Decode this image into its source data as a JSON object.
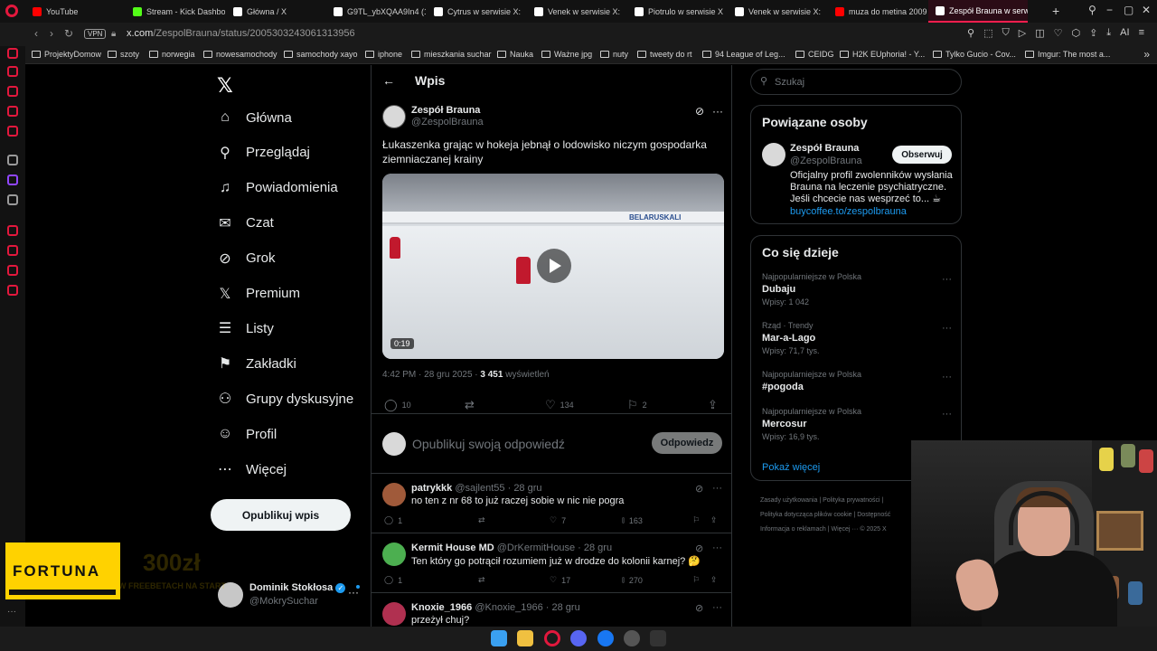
{
  "browser": {
    "tabs": [
      {
        "label": "YouTube",
        "color": "#ff0000"
      },
      {
        "label": "Stream - Kick Dashbo",
        "color": "#53fc18"
      },
      {
        "label": "Główna / X",
        "color": "#ffffff"
      },
      {
        "label": "G9TL_ybXQAA9In4 (1",
        "color": "#ffffff"
      },
      {
        "label": "Cytrus w serwisie X:",
        "color": "#ffffff"
      },
      {
        "label": "Venek w serwisie X:",
        "color": "#ffffff"
      },
      {
        "label": "Piotrulo w serwisie X",
        "color": "#ffffff"
      },
      {
        "label": "Venek w serwisie X:",
        "color": "#ffffff"
      },
      {
        "label": "muza do metina 2009",
        "color": "#ff0000"
      },
      {
        "label": "Zespół Brauna w serwisie",
        "color": "#ffffff"
      }
    ],
    "vpn_label": "VPN",
    "url_domain": "x.com",
    "url_path": "/ZespolBrauna/status/2005303243061313956",
    "bookmarks": [
      "ProjektyDomow",
      "szoty",
      "norwegia",
      "nowesamochody",
      "samochody xayo",
      "iphone",
      "mieszkania suchar",
      "Nauka",
      "Ważne jpg",
      "nuty",
      "tweety do rt",
      "94 League of Leg...",
      "CEIDG",
      "H2K EUphoria! - Y...",
      "Tylko Gucio - Cov...",
      "Imgur: The most a..."
    ],
    "ai_label": "AI"
  },
  "nav": {
    "items": [
      {
        "label": "Główna",
        "icon": "⌂"
      },
      {
        "label": "Przeglądaj",
        "icon": "⚲"
      },
      {
        "label": "Powiadomienia",
        "icon": "♫"
      },
      {
        "label": "Czat",
        "icon": "✉"
      },
      {
        "label": "Grok",
        "icon": "⊘"
      },
      {
        "label": "Premium",
        "icon": "𝕏"
      },
      {
        "label": "Listy",
        "icon": "☰"
      },
      {
        "label": "Zakładki",
        "icon": "⚑"
      },
      {
        "label": "Grupy dyskusyjne",
        "icon": "⚇"
      },
      {
        "label": "Profil",
        "icon": "☺"
      },
      {
        "label": "Więcej",
        "icon": "⋯"
      }
    ],
    "post_button": "Opublikuj wpis",
    "account": {
      "name": "Dominik Stokłosa",
      "handle": "@MokrySuchar"
    }
  },
  "main": {
    "title": "Wpis",
    "tweet": {
      "author_name": "Zespół Brauna",
      "author_handle": "@ZespolBrauna",
      "text": "Łukaszenka grając w hokeja jebnął o lodowisko niczym gospodarka ziemniaczanej krainy",
      "video_duration": "0:19",
      "video_board_ad": "BELARUSKALI",
      "timestamp": "4:42 PM · 28 gru 2025 · ",
      "views_count": "3 451",
      "views_label": " wyświetleń",
      "replies": "10",
      "likes": "134",
      "bookmarks": "2"
    },
    "reply_placeholder": "Opublikuj swoją odpowiedź",
    "reply_button": "Odpowiedz",
    "replies": [
      {
        "name": "patrykkk",
        "handle": "@sajlent55",
        "date": "28 gru",
        "text": "no ten z nr 68 to już raczej sobie w nic nie pogra",
        "replies": "1",
        "likes": "7",
        "views": "163",
        "avatar": "#a05a3a"
      },
      {
        "name": "Kermit House MD",
        "handle": "@DrKermitHouse",
        "date": "28 gru",
        "text": "Ten który go potrącił rozumiem już w drodze do kolonii karnej? 🤔",
        "replies": "1",
        "likes": "17",
        "views": "270",
        "avatar": "#4caf50"
      },
      {
        "name": "Knoxie_1966",
        "handle": "@Knoxie_1966",
        "date": "28 gru",
        "text": "przeżył chuj?",
        "replies": "",
        "likes": "",
        "views": "",
        "avatar": "#b03050"
      }
    ]
  },
  "right": {
    "search_placeholder": "Szukaj",
    "related": {
      "title": "Powiązane osoby",
      "name": "Zespół Brauna",
      "handle": "@ZespolBrauna",
      "follow": "Obserwuj",
      "bio": "Oficjalny profil zwolenników wysłania Brauna na leczenie psychiatryczne. Jeśli chcecie nas wesprzeć to... ☕",
      "link": "buycoffee.to/zespolbrauna"
    },
    "trends": {
      "title": "Co się dzieje",
      "items": [
        {
          "context": "Najpopularniejsze w Polska",
          "name": "Dubaju",
          "count": "Wpisy: 1 042"
        },
        {
          "context": "Rząd · Trendy",
          "name": "Mar-a-Lago",
          "count": "Wpisy: 71,7 tys."
        },
        {
          "context": "Najpopularniejsze w Polska",
          "name": "#pogoda",
          "count": ""
        },
        {
          "context": "Najpopularniejsze w Polska",
          "name": "Mercosur",
          "count": "Wpisy: 16,9 tys."
        }
      ],
      "show_more": "Pokaż więcej"
    },
    "footer": {
      "line1": "Zasady użytkowania  |  Polityka prywatności  |",
      "line2": "Polityka dotycząca plików cookie  |  Dostępność",
      "line3": "Informacja o reklamach  |  Więcej ···  © 2025 X"
    }
  },
  "overlay": {
    "sponsor": "FORTUNA",
    "promo_big": "300zł",
    "promo_small": "W FREEBETACH NA START"
  }
}
